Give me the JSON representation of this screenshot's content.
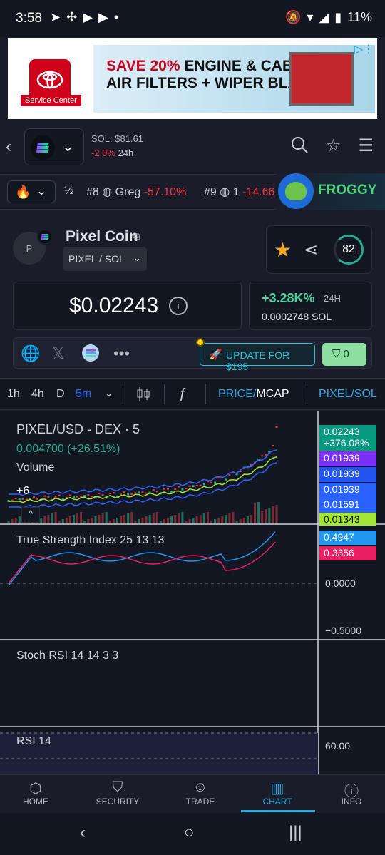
{
  "status_bar": {
    "time": "3:58",
    "battery": "11%"
  },
  "ad": {
    "brand": "Service Center",
    "line1_highlight": "SAVE 20%",
    "line1_rest": "ENGINE & CABIN",
    "line2": "AIR FILTERS + WIPER BLADES"
  },
  "header": {
    "sol_price": "SOL: $81.61",
    "sol_change": "-2.0%",
    "sol_change_period": "24h"
  },
  "trending": {
    "half_label": "½",
    "items": [
      {
        "rank": "#8",
        "name": "Greg",
        "change": "-57.10%"
      },
      {
        "rank": "#9",
        "name": "1",
        "change": "-14.66"
      }
    ],
    "featured": "FROGGY"
  },
  "token": {
    "avatar_letter": "P",
    "name": "Pixel Coin",
    "pair": "PIXEL / SOL",
    "score": "82",
    "price": "$0.02243",
    "change_pct": "+3.28K%",
    "change_period": "24H",
    "price_sol": "0.0002748 SOL",
    "update_label": "UPDATE FOR $195",
    "shield_count": "0"
  },
  "timeframes": {
    "items": [
      "1h",
      "4h",
      "D",
      "5m"
    ],
    "active": "5m",
    "price_label": "PRICE",
    "mcap_label": "MCAP",
    "pair_toggle": "PIXEL/SOL"
  },
  "chart": {
    "main_title": "PIXEL/USD - DEX · 5",
    "main_change": "0.004700 (+26.51%)",
    "volume_label": "Volume",
    "plus_label": "+6",
    "price_tags": [
      {
        "value": "0.02243",
        "sub": "+376.08%",
        "color": "#089981"
      },
      {
        "value": "0.01939",
        "color": "#7b2ff7"
      },
      {
        "value": "0.01939",
        "color": "#2255f0"
      },
      {
        "value": "0.01939",
        "color": "#2962ff"
      },
      {
        "value": "0.01591",
        "color": "#2962ff"
      },
      {
        "value": "0.01343",
        "color": "#a3e635"
      }
    ],
    "tsi_title": "True Strength Index 25 13 13",
    "tsi_tags": [
      {
        "value": "0.4947",
        "color": "#2196f3"
      },
      {
        "value": "0.3356",
        "color": "#e91e63"
      }
    ],
    "tsi_axis": [
      "0.0000",
      "−0.5000"
    ],
    "stoch_title": "Stoch RSI 14 14 3 3",
    "rsi_title": "RSI 14",
    "rsi_axis": [
      "60.00"
    ]
  },
  "chart_data": {
    "type": "line",
    "series": [
      {
        "name": "TSI",
        "last": 0.4947
      },
      {
        "name": "Signal",
        "last": 0.3356
      }
    ]
  },
  "bottom_nav": {
    "items": [
      {
        "label": "HOME",
        "icon": "home-icon"
      },
      {
        "label": "SECURITY",
        "icon": "shield-icon"
      },
      {
        "label": "TRADE",
        "icon": "robot-icon"
      },
      {
        "label": "CHART",
        "icon": "chart-icon"
      },
      {
        "label": "INFO",
        "icon": "info-icon"
      }
    ],
    "active": "CHART"
  }
}
